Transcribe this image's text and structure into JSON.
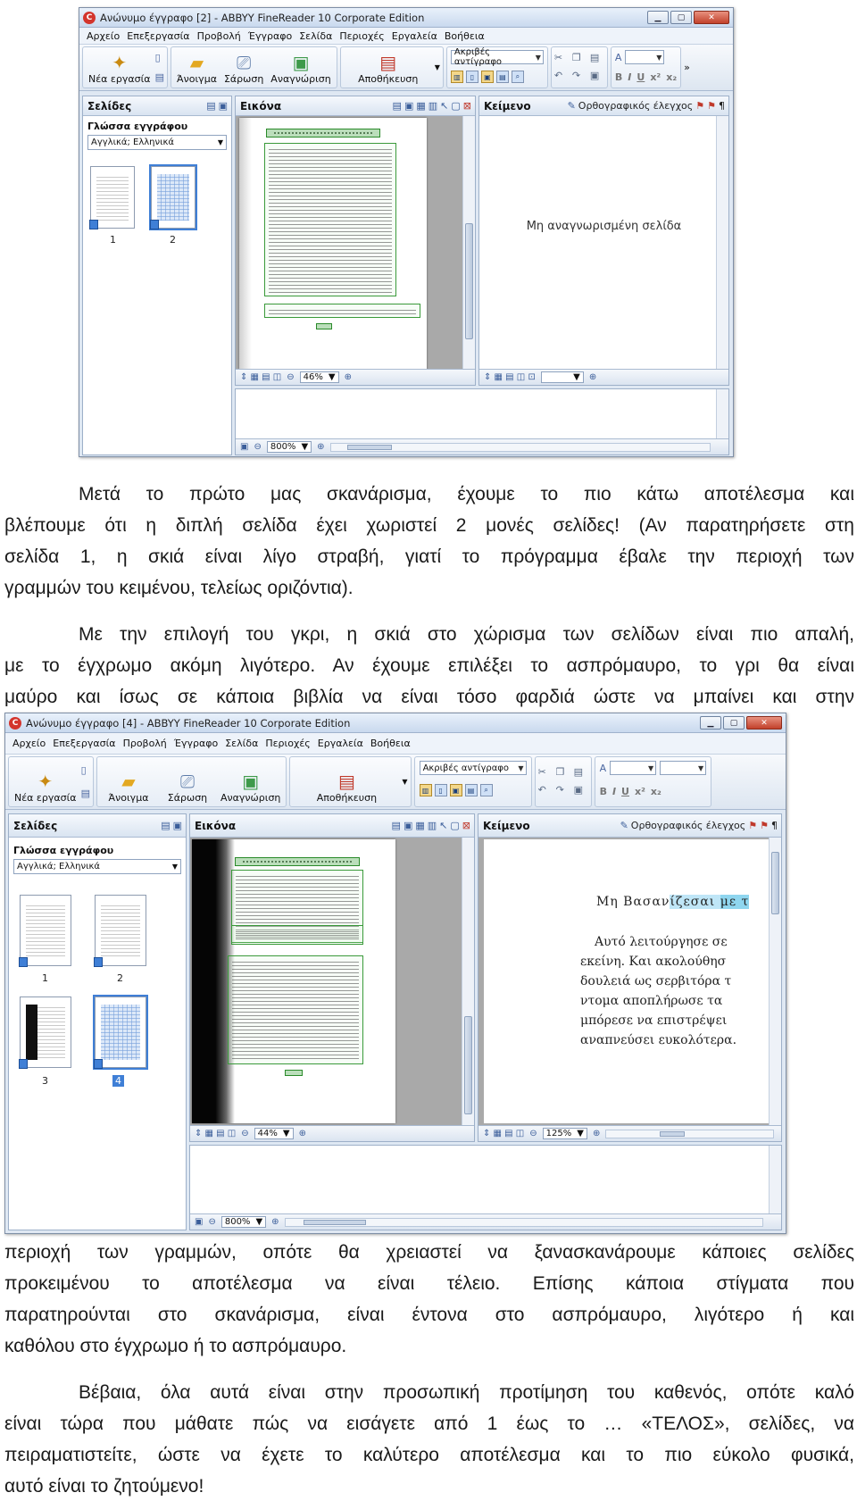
{
  "window1": {
    "title": "Ανώνυμο έγγραφο [2] - ABBYY FineReader 10 Corporate Edition",
    "menu": [
      "Αρχείο",
      "Επεξεργασία",
      "Προβολή",
      "Έγγραφο",
      "Σελίδα",
      "Περιοχές",
      "Εργαλεία",
      "Βοήθεια"
    ],
    "toolbar": {
      "new_task": "Νέα εργασία",
      "open": "Άνοιγμα",
      "scan": "Σάρωση",
      "recognize": "Αναγνώριση",
      "save": "Αποθήκευση",
      "format_mode": "Ακριβές αντίγραφο"
    },
    "pages_pane": {
      "title": "Σελίδες",
      "doc_language_label": "Γλώσσα εγγράφου",
      "doc_language": "Αγγλικά; Ελληνικά",
      "thumbs": [
        "1",
        "2"
      ]
    },
    "image_pane": {
      "title": "Εικόνα",
      "zoom": "46%"
    },
    "text_pane": {
      "title": "Κείμενο",
      "spell_check": "Ορθογραφικός έλεγχος",
      "empty_message": "Μη αναγνωρισμένη σελίδα"
    },
    "zoom_pane": {
      "zoom": "800%"
    }
  },
  "para1": {
    "lines": [
      "Μετά το πρώτο μας σκανάρισμα, έχουμε το πιο κάτω αποτέλεσμα και",
      "βλέπουμε ότι η διπλή σελίδα έχει χωριστεί 2 μονές σελίδες! (Αν παρατηρήσετε στη",
      "σελίδα 1, η σκιά είναι λίγο στραβή, γιατί το πρόγραμμα έβαλε την περιοχή των",
      "γραμμών του κειμένου, τελείως οριζόντια)."
    ]
  },
  "para2": {
    "lines": [
      "Με την επιλογή του γκρι, η σκιά στο χώρισμα των σελίδων είναι πιο απαλή,",
      "με το έγχρωμο ακόμη λιγότερο. Αν έχουμε επιλέξει το ασπρόμαυρο, το γρι θα είναι",
      "μαύρο και ίσως σε κάποια βιβλία να είναι τόσο φαρδιά ώστε να μπαίνει και στην"
    ]
  },
  "window2": {
    "title": "Ανώνυμο έγγραφο [4] - ABBYY FineReader 10 Corporate Edition",
    "menu": [
      "Αρχείο",
      "Επεξεργασία",
      "Προβολή",
      "Έγγραφο",
      "Σελίδα",
      "Περιοχές",
      "Εργαλεία",
      "Βοήθεια"
    ],
    "toolbar": {
      "new_task": "Νέα εργασία",
      "open": "Άνοιγμα",
      "scan": "Σάρωση",
      "recognize": "Αναγνώριση",
      "save": "Αποθήκευση",
      "format_mode": "Ακριβές αντίγραφο"
    },
    "pages_pane": {
      "title": "Σελίδες",
      "doc_language_label": "Γλώσσα εγγράφου",
      "doc_language": "Αγγλικά; Ελληνικά",
      "thumbs": [
        "1",
        "2",
        "3",
        "4"
      ]
    },
    "image_pane": {
      "title": "Εικόνα",
      "zoom": "44%"
    },
    "text_pane": {
      "title": "Κείμενο",
      "spell_check": "Ορθογραφικός έλεγχος",
      "zoom": "125%",
      "heading_a": "Μη Βασαν",
      "heading_b": "ίζεσαι ",
      "heading_c": "με τ",
      "lines": [
        "Αυτό λειτούργησε σε",
        "εκείνη. Και ακολούθησ",
        "δουλειά ως σερβιτόρα τ",
        "ντομα αποπλήρωσε τα",
        "μπόρεσε να επιστρέψει",
        "αναπνεύσει ευκολότερα."
      ]
    },
    "zoom_pane": {
      "zoom": "800%"
    }
  },
  "para3": {
    "lines": [
      "περιοχή των γραμμών, οπότε θα χρειαστεί να ξανασκανάρουμε κάποιες σελίδες",
      "προκειμένου το αποτέλεσμα να είναι τέλειο. Επίσης κάποια στίγματα που",
      "παρατηρούνται στο σκανάρισμα, είναι έντονα στο ασπρόμαυρο, λιγότερο ή και",
      "καθόλου στο έγχρωμο ή το ασπρόμαυρο."
    ]
  },
  "para4": {
    "lines": [
      "Βέβαια, όλα αυτά είναι στην προσωπική προτίμηση του καθενός, οπότε καλό",
      "είναι τώρα που μάθατε πώς να εισάγετε από 1 έως το … «ΤΕΛΟΣ», σελίδες, να",
      "πειραματιστείτε, ώστε να έχετε το καλύτερο αποτέλεσμα και το πιο εύκολο φυσικά,",
      "αυτό είναι το ζητούμενο!"
    ]
  }
}
